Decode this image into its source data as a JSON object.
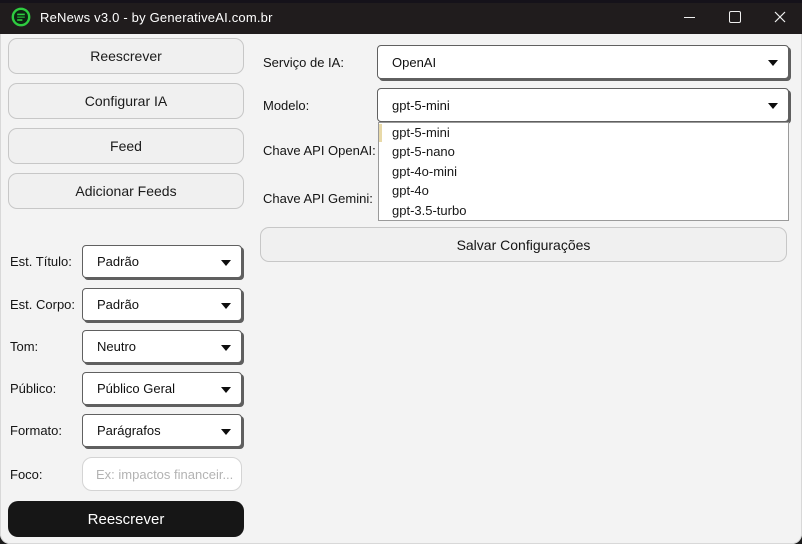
{
  "window": {
    "title": "ReNews v3.0 - by GenerativeAI.com.br"
  },
  "sidebar": {
    "nav_buttons": [
      {
        "label": "Reescrever"
      },
      {
        "label": "Configurar IA"
      },
      {
        "label": "Feed"
      },
      {
        "label": "Adicionar Feeds"
      }
    ],
    "fields": [
      {
        "label": "Est. Título:",
        "value": "Padrão"
      },
      {
        "label": "Est. Corpo:",
        "value": "Padrão"
      },
      {
        "label": "Tom:",
        "value": "Neutro"
      },
      {
        "label": "Público:",
        "value": "Público Geral"
      },
      {
        "label": "Formato:",
        "value": "Parágrafos"
      },
      {
        "label": "Foco:",
        "placeholder": "Ex: impactos financeir..."
      }
    ],
    "rewrite_button": "Reescrever"
  },
  "settings": {
    "service_label": "Serviço de IA:",
    "service_value": "OpenAI",
    "model_label": "Modelo:",
    "model_value": "gpt-5-mini",
    "model_options": [
      "gpt-5-mini",
      "gpt-5-nano",
      "gpt-4o-mini",
      "gpt-4o",
      "gpt-3.5-turbo"
    ],
    "api_openai_label": "Chave API OpenAI:",
    "api_gemini_label": "Chave API Gemini:",
    "save_button": "Salvar Configurações"
  },
  "colors": {
    "titlebar_bg": "#201c1d",
    "content_bg": "#f3f3f3",
    "primary_button_bg": "#161616",
    "icon_green": "#2ecc40",
    "selection_marker": "#e8d9a8"
  }
}
